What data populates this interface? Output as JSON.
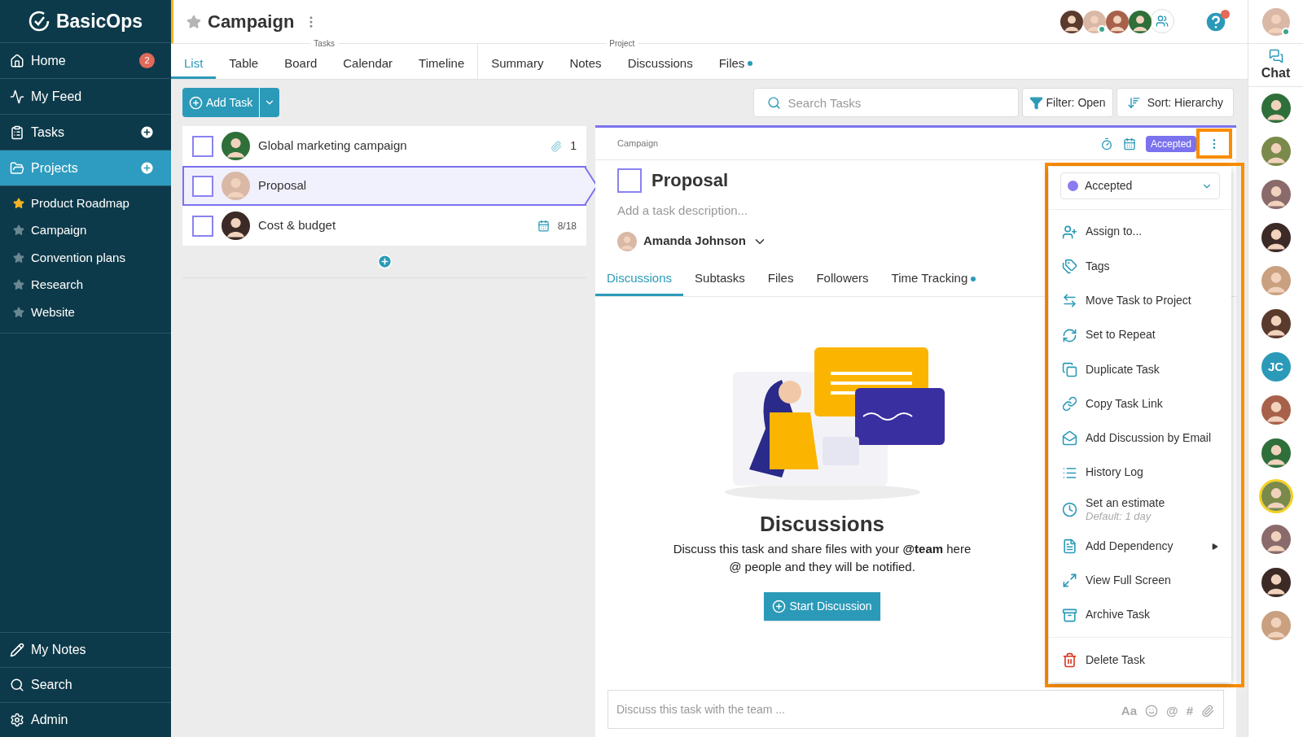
{
  "sidebar": {
    "logo": "BasicOps",
    "nav": [
      {
        "kind": "home",
        "label": "Home",
        "badge": "2",
        "selected": false,
        "add": false
      },
      {
        "kind": "feed",
        "label": "My Feed",
        "selected": false,
        "add": false
      },
      {
        "kind": "tasks",
        "label": "Tasks",
        "add": true,
        "selected": false
      },
      {
        "kind": "projects",
        "label": "Projects",
        "add": true,
        "selected": true
      }
    ],
    "projects": [
      {
        "label": "Product Roadmap",
        "favorite": true
      },
      {
        "label": "Campaign",
        "favorite": false
      },
      {
        "label": "Convention plans",
        "favorite": false
      },
      {
        "label": "Research",
        "favorite": false
      },
      {
        "label": "Website",
        "favorite": false
      }
    ],
    "bottom": [
      {
        "kind": "notes",
        "label": "My Notes"
      },
      {
        "kind": "search",
        "label": "Search"
      },
      {
        "kind": "admin",
        "label": "Admin"
      }
    ]
  },
  "header": {
    "title": "Campaign",
    "favorite": false,
    "members": [
      {
        "kind": "photo",
        "online": false
      },
      {
        "kind": "photo",
        "online": true
      },
      {
        "kind": "photo",
        "online": false
      },
      {
        "kind": "photo",
        "online": false
      },
      {
        "kind": "group"
      }
    ],
    "help_notification": true
  },
  "tab_groups": [
    {
      "label": "Tasks",
      "tabs": [
        {
          "label": "List",
          "selected": true,
          "dot": false
        },
        {
          "label": "Table",
          "selected": false,
          "dot": false
        },
        {
          "label": "Board",
          "selected": false,
          "dot": false
        },
        {
          "label": "Calendar",
          "selected": false,
          "dot": false
        },
        {
          "label": "Timeline",
          "selected": false,
          "dot": false
        }
      ]
    },
    {
      "label": "Project",
      "tabs": [
        {
          "label": "Summary",
          "selected": false,
          "dot": false
        },
        {
          "label": "Notes",
          "selected": false,
          "dot": false
        },
        {
          "label": "Discussions",
          "selected": false,
          "dot": false
        },
        {
          "label": "Files",
          "selected": false,
          "dot": true
        }
      ]
    }
  ],
  "toolbar": {
    "add_task": "Add Task",
    "search": {
      "placeholder": "Search Tasks"
    },
    "filter": "Filter: Open",
    "sort": "Sort: Hierarchy"
  },
  "tasks": [
    {
      "title": "Global marketing campaign",
      "checked": false,
      "selected": false,
      "kind": "attachment",
      "meta": "1"
    },
    {
      "title": "Proposal",
      "checked": false,
      "selected": true,
      "kind": "plain"
    },
    {
      "title": "Cost & budget",
      "checked": false,
      "selected": false,
      "kind": "date",
      "meta": "8/18"
    }
  ],
  "detail": {
    "breadcrumb": "Campaign",
    "status": "Accepted",
    "checked": false,
    "title": "Proposal",
    "description": {
      "placeholder": "Add a task description..."
    },
    "assignee": "Amanda Johnson",
    "tabs": [
      {
        "label": "Discussions",
        "selected": true,
        "dot": false
      },
      {
        "label": "Subtasks",
        "selected": false,
        "dot": false
      },
      {
        "label": "Files",
        "selected": false,
        "dot": false
      },
      {
        "label": "Followers",
        "selected": false,
        "dot": false
      },
      {
        "label": "Time Tracking",
        "selected": false,
        "dot": true
      }
    ],
    "empty": {
      "heading": "Discussions",
      "lines": [
        "Discuss this task and share files with your **@team** here",
        "@ people and they will be notified."
      ],
      "button": "Start Discussion"
    },
    "composer": {
      "placeholder": "Discuss this task with the team ...",
      "tools": [
        {
          "kind": "text",
          "label": "Aa"
        },
        {
          "kind": "emoji"
        },
        {
          "kind": "text",
          "label": "@"
        },
        {
          "kind": "text",
          "label": "#"
        },
        {
          "kind": "attach"
        }
      ]
    }
  },
  "menu": {
    "status": {
      "label": "Accepted",
      "color": "#8a7cf0"
    },
    "items": [
      {
        "kind": "assign",
        "label": "Assign to...",
        "submenu": false
      },
      {
        "kind": "tags",
        "label": "Tags",
        "submenu": false
      },
      {
        "kind": "move",
        "label": "Move Task to Project",
        "submenu": false
      },
      {
        "kind": "repeat",
        "label": "Set to Repeat",
        "submenu": false
      },
      {
        "kind": "duplicate",
        "label": "Duplicate Task",
        "submenu": false
      },
      {
        "kind": "link",
        "label": "Copy Task Link",
        "submenu": false
      },
      {
        "kind": "email",
        "label": "Add Discussion by Email",
        "submenu": false
      },
      {
        "kind": "history",
        "label": "History Log",
        "submenu": false
      },
      {
        "kind": "estimate",
        "label": "Set an estimate",
        "sub": "Default: 1 day",
        "submenu": false
      },
      {
        "kind": "dependency",
        "label": "Add Dependency",
        "submenu": true
      },
      {
        "kind": "fullscreen",
        "label": "View Full Screen",
        "submenu": false
      },
      {
        "kind": "archive",
        "label": "Archive Task",
        "submenu": false
      }
    ],
    "delete": "Delete Task"
  },
  "rail": {
    "user_online": true,
    "chat": "Chat",
    "people": [
      {
        "kind": "photo",
        "highlighted": false
      },
      {
        "kind": "photo",
        "highlighted": false
      },
      {
        "kind": "photo",
        "highlighted": false
      },
      {
        "kind": "photo",
        "highlighted": false
      },
      {
        "kind": "photo",
        "highlighted": false
      },
      {
        "kind": "photo",
        "highlighted": false
      },
      {
        "kind": "initials",
        "initials": "JC",
        "highlighted": false
      },
      {
        "kind": "photo",
        "highlighted": false
      },
      {
        "kind": "photo",
        "highlighted": false
      },
      {
        "kind": "photo",
        "highlighted": true
      },
      {
        "kind": "photo",
        "highlighted": false
      },
      {
        "kind": "photo",
        "highlighted": false
      },
      {
        "kind": "photo",
        "highlighted": false
      }
    ]
  }
}
